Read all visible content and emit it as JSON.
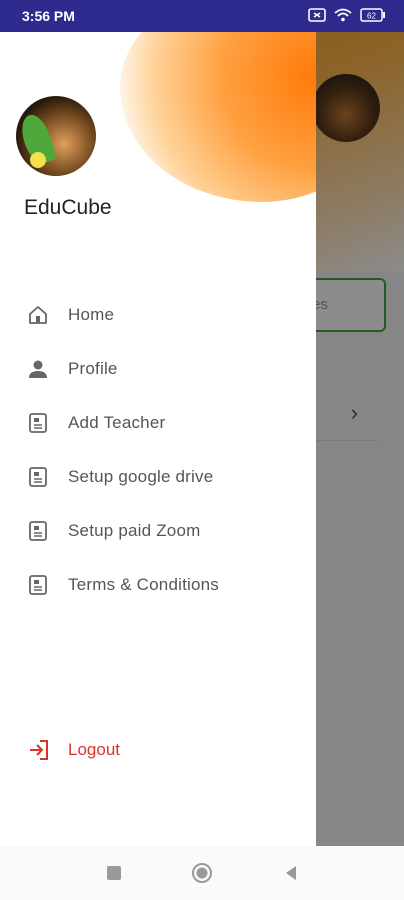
{
  "status_bar": {
    "time": "3:56 PM",
    "battery": "62",
    "icons": [
      "screen-record-icon",
      "wifi-icon",
      "battery-icon"
    ]
  },
  "background": {
    "field_hint": "es",
    "row_chevron": "›"
  },
  "drawer": {
    "app_name": "EduCube",
    "items": [
      {
        "label": "Home",
        "icon": "home-icon"
      },
      {
        "label": "Profile",
        "icon": "person-icon"
      },
      {
        "label": "Add Teacher",
        "icon": "document-icon"
      },
      {
        "label": "Setup google drive",
        "icon": "document-icon"
      },
      {
        "label": "Setup paid Zoom",
        "icon": "document-icon"
      },
      {
        "label": "Terms & Conditions",
        "icon": "document-icon"
      }
    ],
    "logout": {
      "label": "Logout",
      "icon": "logout-icon"
    }
  },
  "nav_bar": {
    "buttons": [
      "recents-button",
      "home-button",
      "back-button"
    ]
  },
  "colors": {
    "status_bar": "#2e2a8e",
    "accent_orange": "#ff7a0a",
    "logout_red": "#d9342b",
    "field_border_green": "#3fa83f"
  }
}
